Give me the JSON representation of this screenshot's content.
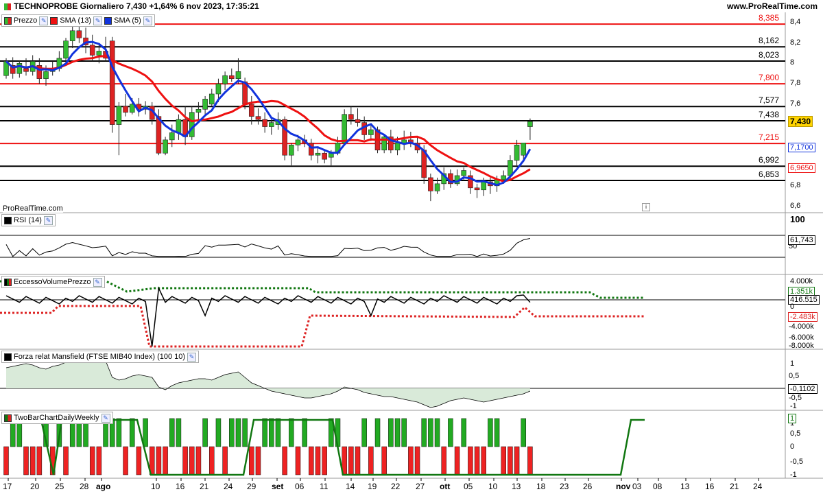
{
  "header": {
    "title": "TECHNOPROBE Giornaliero 7,430 +1,64% 6 nov 2023, 17:35:21",
    "site": "www.ProRealTime.com",
    "watermark": "ProRealTime.com",
    "info_icon": "i"
  },
  "legend": {
    "price": "Prezzo",
    "sma13": "SMA (13)",
    "sma5": "SMA (5)",
    "colors": {
      "sma13": "#ee1111",
      "sma5": "#1133dd",
      "up": "#33bb33",
      "down": "#dd2222"
    }
  },
  "panels": {
    "rsi": "RSI (14)",
    "evp": "EccessoVolumePrezzo",
    "mansfield": "Forza relat Mansfield (FTSE MIB40 Index) (100 10)",
    "twobar": "TwoBarChartDailyWeekly"
  },
  "xaxis": {
    "ticks": [
      "17",
      "20",
      "25",
      "28",
      "ago",
      "10",
      "16",
      "21",
      "24",
      "29",
      "set",
      "06",
      "11",
      "14",
      "19",
      "22",
      "27",
      "ott",
      "05",
      "10",
      "13",
      "18",
      "23",
      "26",
      "nov",
      "03",
      "08",
      "13",
      "16",
      "21",
      "24"
    ]
  },
  "price_axis": {
    "ticks": [
      "8,4",
      "8,2",
      "8",
      "7,8",
      "7,6",
      "6,8",
      "6,6"
    ],
    "current": "7,430",
    "sma5_value": "7,1700",
    "sma13_value": "6,9650"
  },
  "levels": [
    {
      "value": 8.385,
      "label": "8,385",
      "color": "red"
    },
    {
      "value": 8.162,
      "label": "8,162",
      "color": "black"
    },
    {
      "value": 8.023,
      "label": "8,023",
      "color": "black"
    },
    {
      "value": 7.8,
      "label": "7,800",
      "color": "red"
    },
    {
      "value": 7.577,
      "label": "7,577",
      "color": "black"
    },
    {
      "value": 7.438,
      "label": "7,438",
      "color": "black"
    },
    {
      "value": 7.215,
      "label": "7,215",
      "color": "red"
    },
    {
      "value": 6.992,
      "label": "6,992",
      "color": "black"
    },
    {
      "value": 6.853,
      "label": "6,853",
      "color": "black"
    }
  ],
  "rsi_axis": {
    "ticks": [
      "100",
      "50"
    ],
    "value": "61,743"
  },
  "evp_axis": {
    "ticks": [
      "4.000k",
      "-4.000k",
      "-6.000k",
      "-8.000k"
    ],
    "green_value": "1.351k",
    "black_value": "416.515",
    "zero": "0",
    "red_value": "-2.483k"
  },
  "mansfield_axis": {
    "ticks": [
      "1",
      "0,5",
      "-0,5",
      "-1"
    ],
    "value": "-0,1102"
  },
  "twobar_axis": {
    "ticks": [
      "1",
      "0,5",
      "0",
      "-0,5",
      "-1"
    ],
    "value": "1"
  },
  "chart_data": {
    "type": "candlestick",
    "title": "TECHNOPROBE Giornaliero",
    "ylim": [
      6.55,
      8.5
    ],
    "candles": [
      [
        7.88,
        8.05,
        7.85,
        8.02
      ],
      [
        7.98,
        8.06,
        7.85,
        7.9
      ],
      [
        7.9,
        8.03,
        7.86,
        8.0
      ],
      [
        7.95,
        8.05,
        7.88,
        7.92
      ],
      [
        7.92,
        8.08,
        7.88,
        8.02
      ],
      [
        7.98,
        8.05,
        7.8,
        7.85
      ],
      [
        7.85,
        7.98,
        7.78,
        7.92
      ],
      [
        7.92,
        8.02,
        7.88,
        7.95
      ],
      [
        7.95,
        8.12,
        7.92,
        8.05
      ],
      [
        8.05,
        8.25,
        7.98,
        8.22
      ],
      [
        8.22,
        8.38,
        8.15,
        8.32
      ],
      [
        8.32,
        8.4,
        8.2,
        8.25
      ],
      [
        8.25,
        8.35,
        8.1,
        8.18
      ],
      [
        8.18,
        8.28,
        8.02,
        8.08
      ],
      [
        8.08,
        8.2,
        8.0,
        8.12
      ],
      [
        8.12,
        8.26,
        8.02,
        8.05
      ],
      [
        8.22,
        8.26,
        7.32,
        7.4
      ],
      [
        7.4,
        7.62,
        7.1,
        7.58
      ],
      [
        7.58,
        7.7,
        7.48,
        7.52
      ],
      [
        7.52,
        7.66,
        7.5,
        7.6
      ],
      [
        7.6,
        7.66,
        7.48,
        7.55
      ],
      [
        7.55,
        7.63,
        7.5,
        7.58
      ],
      [
        7.58,
        7.62,
        7.4,
        7.45
      ],
      [
        7.48,
        7.55,
        7.1,
        7.12
      ],
      [
        7.12,
        7.28,
        7.1,
        7.25
      ],
      [
        7.25,
        7.4,
        7.18,
        7.32
      ],
      [
        7.32,
        7.5,
        7.25,
        7.45
      ],
      [
        7.45,
        7.58,
        7.2,
        7.28
      ],
      [
        7.28,
        7.58,
        7.25,
        7.52
      ],
      [
        7.52,
        7.62,
        7.45,
        7.55
      ],
      [
        7.55,
        7.68,
        7.5,
        7.65
      ],
      [
        7.6,
        7.75,
        7.58,
        7.7
      ],
      [
        7.7,
        7.85,
        7.62,
        7.8
      ],
      [
        7.8,
        7.92,
        7.74,
        7.88
      ],
      [
        7.88,
        7.95,
        7.82,
        7.85
      ],
      [
        7.85,
        8.05,
        7.8,
        7.92
      ],
      [
        7.82,
        7.86,
        7.55,
        7.6
      ],
      [
        7.6,
        7.68,
        7.4,
        7.48
      ],
      [
        7.48,
        7.56,
        7.4,
        7.45
      ],
      [
        7.45,
        7.52,
        7.32,
        7.38
      ],
      [
        7.38,
        7.46,
        7.3,
        7.42
      ],
      [
        7.4,
        7.52,
        7.35,
        7.45
      ],
      [
        7.45,
        7.48,
        7.05,
        7.1
      ],
      [
        7.1,
        7.22,
        7.0,
        7.2
      ],
      [
        7.2,
        7.3,
        7.14,
        7.25
      ],
      [
        7.25,
        7.3,
        7.18,
        7.22
      ],
      [
        7.22,
        7.26,
        7.05,
        7.1
      ],
      [
        7.1,
        7.18,
        7.02,
        7.12
      ],
      [
        7.12,
        7.16,
        7.02,
        7.06
      ],
      [
        7.08,
        7.15,
        7.0,
        7.12
      ],
      [
        7.12,
        7.28,
        7.1,
        7.22
      ],
      [
        7.22,
        7.55,
        7.2,
        7.5
      ],
      [
        7.5,
        7.58,
        7.4,
        7.45
      ],
      [
        7.45,
        7.56,
        7.38,
        7.42
      ],
      [
        7.42,
        7.48,
        7.25,
        7.3
      ],
      [
        7.3,
        7.4,
        7.24,
        7.35
      ],
      [
        7.35,
        7.38,
        7.12,
        7.15
      ],
      [
        7.15,
        7.3,
        7.12,
        7.28
      ],
      [
        7.28,
        7.35,
        7.12,
        7.15
      ],
      [
        7.15,
        7.28,
        7.1,
        7.22
      ],
      [
        7.22,
        7.34,
        7.15,
        7.25
      ],
      [
        7.25,
        7.33,
        7.18,
        7.22
      ],
      [
        7.22,
        7.28,
        7.12,
        7.15
      ],
      [
        7.15,
        7.2,
        6.82,
        6.88
      ],
      [
        6.88,
        6.92,
        6.65,
        6.75
      ],
      [
        6.75,
        6.88,
        6.72,
        6.82
      ],
      [
        6.82,
        6.98,
        6.76,
        6.92
      ],
      [
        6.92,
        6.96,
        6.78,
        6.82
      ],
      [
        6.82,
        6.96,
        6.8,
        6.9
      ],
      [
        6.9,
        6.98,
        6.85,
        6.95
      ],
      [
        6.9,
        6.95,
        6.72,
        6.78
      ],
      [
        6.78,
        6.82,
        6.68,
        6.76
      ],
      [
        6.76,
        6.88,
        6.7,
        6.84
      ],
      [
        6.84,
        6.88,
        6.72,
        6.8
      ],
      [
        6.8,
        6.9,
        6.74,
        6.86
      ],
      [
        6.86,
        6.95,
        6.82,
        6.9
      ],
      [
        6.9,
        7.1,
        6.86,
        7.05
      ],
      [
        7.05,
        7.25,
        7.0,
        7.2
      ],
      [
        7.1,
        7.22,
        7.05,
        7.22
      ],
      [
        7.38,
        7.46,
        7.25,
        7.43
      ]
    ]
  }
}
